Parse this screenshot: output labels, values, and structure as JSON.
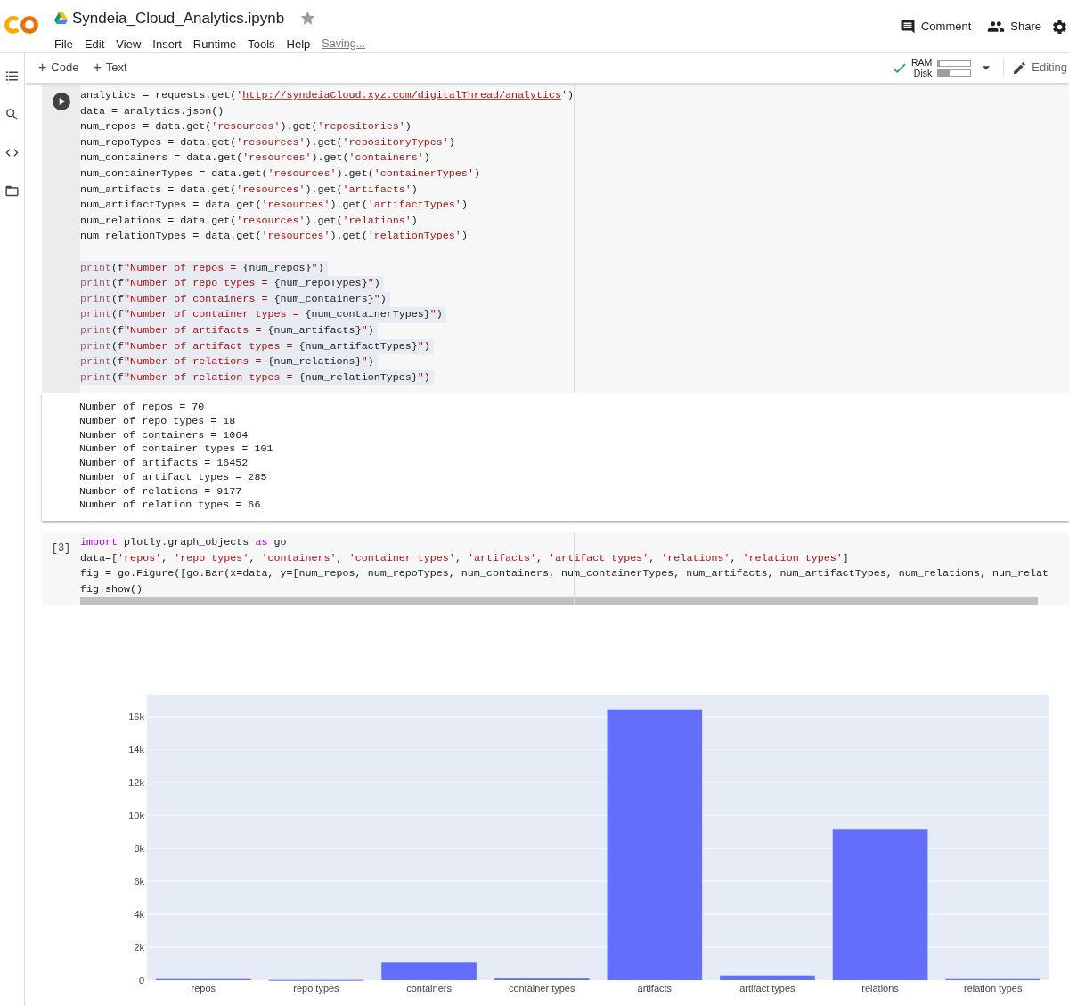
{
  "header": {
    "title": "Syndeia_Cloud_Analytics.ipynb",
    "starred": false,
    "menu": [
      "File",
      "Edit",
      "View",
      "Insert",
      "Runtime",
      "Tools",
      "Help"
    ],
    "save_status": "Saving...",
    "actions": [
      "Comment",
      "Share"
    ]
  },
  "toolbar": {
    "add_buttons": [
      {
        "icon": "+",
        "label": "Code"
      },
      {
        "icon": "+",
        "label": "Text"
      }
    ],
    "connected": true,
    "resources": [
      {
        "label": "RAM",
        "level": 0.04
      },
      {
        "label": "Disk",
        "level": 0.35
      }
    ],
    "mode": "Editing"
  },
  "cells": [
    {
      "running": true,
      "lines": [
        {
          "highlighted": false,
          "parts": [
            {
              "kind": "plain",
              "text": "analytics = requests.get("
            },
            {
              "kind": "string",
              "text": "'"
            },
            {
              "kind": "link",
              "text": "http://syndeiaCloud.xyz.com/digitalThread/analytics"
            },
            {
              "kind": "string",
              "text": "'"
            },
            {
              "kind": "plain",
              "text": ")"
            }
          ]
        },
        {
          "highlighted": false,
          "parts": [
            {
              "kind": "plain",
              "text": "data = analytics.json()"
            }
          ]
        },
        {
          "highlighted": false,
          "parts": [
            {
              "kind": "plain",
              "text": "num_repos = data.get("
            },
            {
              "kind": "string",
              "text": "'resources'"
            },
            {
              "kind": "plain",
              "text": ").get("
            },
            {
              "kind": "string",
              "text": "'repositories'"
            },
            {
              "kind": "plain",
              "text": ")"
            }
          ]
        },
        {
          "highlighted": false,
          "parts": [
            {
              "kind": "plain",
              "text": "num_repoTypes = data.get("
            },
            {
              "kind": "string",
              "text": "'resources'"
            },
            {
              "kind": "plain",
              "text": ").get("
            },
            {
              "kind": "string",
              "text": "'repositoryTypes'"
            },
            {
              "kind": "plain",
              "text": ")"
            }
          ]
        },
        {
          "highlighted": false,
          "parts": [
            {
              "kind": "plain",
              "text": "num_containers = data.get("
            },
            {
              "kind": "string",
              "text": "'resources'"
            },
            {
              "kind": "plain",
              "text": ").get("
            },
            {
              "kind": "string",
              "text": "'containers'"
            },
            {
              "kind": "plain",
              "text": ")"
            }
          ]
        },
        {
          "highlighted": false,
          "parts": [
            {
              "kind": "plain",
              "text": "num_containerTypes = data.get("
            },
            {
              "kind": "string",
              "text": "'resources'"
            },
            {
              "kind": "plain",
              "text": ").get("
            },
            {
              "kind": "string",
              "text": "'containerTypes'"
            },
            {
              "kind": "plain",
              "text": ")"
            }
          ]
        },
        {
          "highlighted": false,
          "parts": [
            {
              "kind": "plain",
              "text": "num_artifacts = data.get("
            },
            {
              "kind": "string",
              "text": "'resources'"
            },
            {
              "kind": "plain",
              "text": ").get("
            },
            {
              "kind": "string",
              "text": "'artifacts'"
            },
            {
              "kind": "plain",
              "text": ")"
            }
          ]
        },
        {
          "highlighted": false,
          "parts": [
            {
              "kind": "plain",
              "text": "num_artifactTypes = data.get("
            },
            {
              "kind": "string",
              "text": "'resources'"
            },
            {
              "kind": "plain",
              "text": ").get("
            },
            {
              "kind": "string",
              "text": "'artifactTypes'"
            },
            {
              "kind": "plain",
              "text": ")"
            }
          ]
        },
        {
          "highlighted": false,
          "parts": [
            {
              "kind": "plain",
              "text": "num_relations = data.get("
            },
            {
              "kind": "string",
              "text": "'resources'"
            },
            {
              "kind": "plain",
              "text": ").get("
            },
            {
              "kind": "string",
              "text": "'relations'"
            },
            {
              "kind": "plain",
              "text": ")"
            }
          ]
        },
        {
          "highlighted": false,
          "parts": [
            {
              "kind": "plain",
              "text": "num_relationTypes = data.get("
            },
            {
              "kind": "string",
              "text": "'resources'"
            },
            {
              "kind": "plain",
              "text": ").get("
            },
            {
              "kind": "string",
              "text": "'relationTypes'"
            },
            {
              "kind": "plain",
              "text": ")"
            }
          ]
        },
        {
          "highlighted": false
        },
        {
          "highlighted": true,
          "parts": [
            {
              "kind": "builtin",
              "text": "print"
            },
            {
              "kind": "plain",
              "text": "(f"
            },
            {
              "kind": "string",
              "text": "\"Number of repos = "
            },
            {
              "kind": "plain",
              "text": "{num_repos}"
            },
            {
              "kind": "string",
              "text": "\""
            },
            {
              "kind": "plain",
              "text": ")"
            }
          ]
        },
        {
          "highlighted": true,
          "parts": [
            {
              "kind": "builtin",
              "text": "print"
            },
            {
              "kind": "plain",
              "text": "(f"
            },
            {
              "kind": "string",
              "text": "\"Number of repo types = "
            },
            {
              "kind": "plain",
              "text": "{num_repoTypes}"
            },
            {
              "kind": "string",
              "text": "\""
            },
            {
              "kind": "plain",
              "text": ")"
            }
          ]
        },
        {
          "highlighted": true,
          "parts": [
            {
              "kind": "builtin",
              "text": "print"
            },
            {
              "kind": "plain",
              "text": "(f"
            },
            {
              "kind": "string",
              "text": "\"Number of containers = "
            },
            {
              "kind": "plain",
              "text": "{num_containers}"
            },
            {
              "kind": "string",
              "text": "\""
            },
            {
              "kind": "plain",
              "text": ")"
            }
          ]
        },
        {
          "highlighted": true,
          "parts": [
            {
              "kind": "builtin",
              "text": "print"
            },
            {
              "kind": "plain",
              "text": "(f"
            },
            {
              "kind": "string",
              "text": "\"Number of container types = "
            },
            {
              "kind": "plain",
              "text": "{num_containerTypes}"
            },
            {
              "kind": "string",
              "text": "\""
            },
            {
              "kind": "plain",
              "text": ")"
            }
          ]
        },
        {
          "highlighted": true,
          "parts": [
            {
              "kind": "builtin",
              "text": "print"
            },
            {
              "kind": "plain",
              "text": "(f"
            },
            {
              "kind": "string",
              "text": "\"Number of artifacts = "
            },
            {
              "kind": "plain",
              "text": "{num_artifacts}"
            },
            {
              "kind": "string",
              "text": "\""
            },
            {
              "kind": "plain",
              "text": ")"
            }
          ]
        },
        {
          "highlighted": true,
          "parts": [
            {
              "kind": "builtin",
              "text": "print"
            },
            {
              "kind": "plain",
              "text": "(f"
            },
            {
              "kind": "string",
              "text": "\"Number of artifact types = "
            },
            {
              "kind": "plain",
              "text": "{num_artifactTypes}"
            },
            {
              "kind": "string",
              "text": "\""
            },
            {
              "kind": "plain",
              "text": ")"
            }
          ]
        },
        {
          "highlighted": true,
          "parts": [
            {
              "kind": "builtin",
              "text": "print"
            },
            {
              "kind": "plain",
              "text": "(f"
            },
            {
              "kind": "string",
              "text": "\"Number of relations = "
            },
            {
              "kind": "plain",
              "text": "{num_relations}"
            },
            {
              "kind": "string",
              "text": "\""
            },
            {
              "kind": "plain",
              "text": ")"
            }
          ]
        },
        {
          "highlighted": true,
          "parts": [
            {
              "kind": "builtin",
              "text": "print"
            },
            {
              "kind": "plain",
              "text": "(f"
            },
            {
              "kind": "string",
              "text": "\"Number of relation types = "
            },
            {
              "kind": "plain",
              "text": "{num_relationTypes}"
            },
            {
              "kind": "string",
              "text": "\""
            },
            {
              "kind": "plain",
              "text": ")"
            }
          ]
        }
      ],
      "output": {
        "kind": "text",
        "lines": [
          "Number of repos = 70",
          "Number of repo types = 18",
          "Number of containers = 1064",
          "Number of container types = 101",
          "Number of artifacts = 16452",
          "Number of artifact types = 285",
          "Number of relations = 9177",
          "Number of relation types = 66"
        ]
      }
    },
    {
      "prompt": "[3]",
      "running": false,
      "lines": [
        {
          "highlighted": false,
          "parts": [
            {
              "kind": "keyword",
              "text": "import"
            },
            {
              "kind": "plain",
              "text": " plotly.graph_objects "
            },
            {
              "kind": "keyword",
              "text": "as"
            },
            {
              "kind": "plain",
              "text": " go"
            }
          ]
        },
        {
          "highlighted": false,
          "parts": [
            {
              "kind": "plain",
              "text": "data=["
            },
            {
              "kind": "string",
              "text": "'repos'"
            },
            {
              "kind": "plain",
              "text": ", "
            },
            {
              "kind": "string",
              "text": "'repo types'"
            },
            {
              "kind": "plain",
              "text": ", "
            },
            {
              "kind": "string",
              "text": "'containers'"
            },
            {
              "kind": "plain",
              "text": ", "
            },
            {
              "kind": "string",
              "text": "'container types'"
            },
            {
              "kind": "plain",
              "text": ", "
            },
            {
              "kind": "string",
              "text": "'artifacts'"
            },
            {
              "kind": "plain",
              "text": ", "
            },
            {
              "kind": "string",
              "text": "'artifact types'"
            },
            {
              "kind": "plain",
              "text": ", "
            },
            {
              "kind": "string",
              "text": "'relations'"
            },
            {
              "kind": "plain",
              "text": ", "
            },
            {
              "kind": "string",
              "text": "'relation types'"
            },
            {
              "kind": "plain",
              "text": "]"
            }
          ]
        },
        {
          "highlighted": false,
          "parts": [
            {
              "kind": "plain",
              "text": "fig = go.Figure([go.Bar(x=data, y=[num_repos, num_repoTypes, num_containers, num_containerTypes, num_artifacts, num_artifactTypes, num_relations, num_relat"
            }
          ]
        },
        {
          "highlighted": false,
          "parts": [
            {
              "kind": "plain",
              "text": "fig.show()"
            }
          ]
        }
      ],
      "output": {
        "kind": "chart",
        "chart_data": {
          "type": "bar",
          "grid": true,
          "categories": [
            "repos",
            "repo types",
            "containers",
            "container types",
            "artifacts",
            "artifact types",
            "relations",
            "relation types"
          ],
          "values": [
            70,
            18,
            1064,
            101,
            16452,
            285,
            9177,
            66
          ],
          "ylim": [
            0,
            17300
          ],
          "yticks": [
            {
              "value": 0,
              "label": "0"
            },
            {
              "value": 2000,
              "label": "2k"
            },
            {
              "value": 4000,
              "label": "4k"
            },
            {
              "value": 6000,
              "label": "6k"
            },
            {
              "value": 8000,
              "label": "8k"
            },
            {
              "value": 10000,
              "label": "10k"
            },
            {
              "value": 12000,
              "label": "12k"
            },
            {
              "value": 14000,
              "label": "14k"
            },
            {
              "value": 16000,
              "label": "16k"
            }
          ]
        }
      }
    }
  ]
}
